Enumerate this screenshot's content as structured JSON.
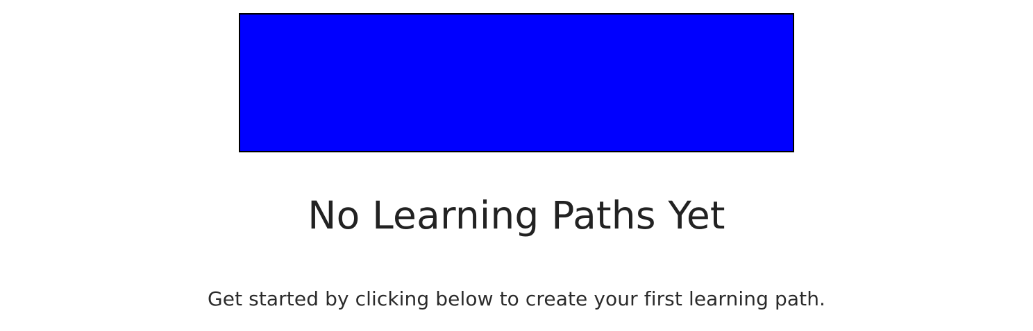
{
  "empty_state": {
    "illustration_color": "#0000ff",
    "title": "No Learning Paths Yet",
    "description": "Get started by clicking below to create your first learning path."
  }
}
